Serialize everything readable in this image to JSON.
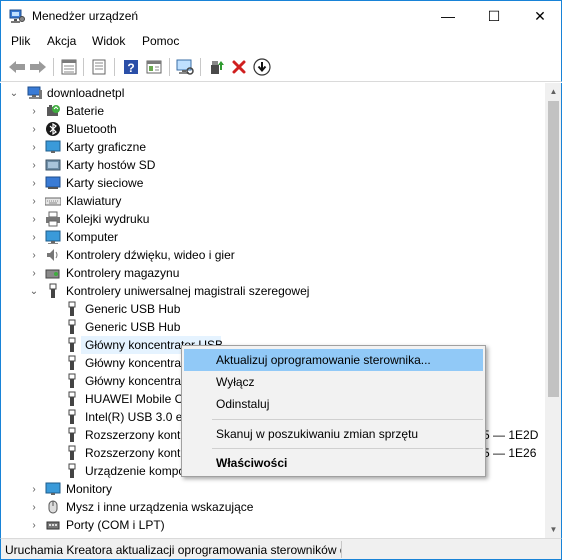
{
  "window": {
    "title": "Menedżer urządzeń",
    "minimize": "—",
    "maximize": "☐",
    "close": "✕"
  },
  "menu": [
    "Plik",
    "Akcja",
    "Widok",
    "Pomoc"
  ],
  "toolbar": {
    "icons": [
      "back-icon",
      "forward-icon",
      "properties-view-icon",
      "list-view-icon",
      "help-icon",
      "details-icon",
      "monitor-scan-icon",
      "update-driver-icon",
      "uninstall-icon",
      "disable-icon"
    ]
  },
  "tree": {
    "root": "downloadnetpl",
    "categories": [
      {
        "label": "Baterie",
        "icon": "battery-icon"
      },
      {
        "label": "Bluetooth",
        "icon": "bluetooth-icon"
      },
      {
        "label": "Karty graficzne",
        "icon": "display-adapter-icon"
      },
      {
        "label": "Karty hostów SD",
        "icon": "sd-host-icon"
      },
      {
        "label": "Karty sieciowe",
        "icon": "network-adapter-icon"
      },
      {
        "label": "Klawiatury",
        "icon": "keyboard-icon"
      },
      {
        "label": "Kolejki wydruku",
        "icon": "printer-icon"
      },
      {
        "label": "Komputer",
        "icon": "computer-icon"
      },
      {
        "label": "Kontrolery dźwięku, wideo i gier",
        "icon": "speaker-icon"
      },
      {
        "label": "Kontrolery magazynu",
        "icon": "storage-icon"
      },
      {
        "label": "Kontrolery uniwersalnej magistrali szeregowej",
        "icon": "usb-icon",
        "expanded": true
      }
    ],
    "usb_children": [
      {
        "label": "Generic USB Hub"
      },
      {
        "label": "Generic USB Hub"
      },
      {
        "label": "Główny koncentrator USB",
        "selected": true
      },
      {
        "label": "Główny koncentrat"
      },
      {
        "label": "Główny koncentrat"
      },
      {
        "label": "HUAWEI Mobile C"
      },
      {
        "label": "Intel(R) USB 3.0 eX"
      },
      {
        "label": "Rozszerzony kontr",
        "suffix": "5 — 1E2D"
      },
      {
        "label": "Rozszerzony kontr",
        "suffix": "5 — 1E26"
      },
      {
        "label": "Urządzenie kompo"
      }
    ],
    "after": [
      {
        "label": "Monitory",
        "icon": "monitor-icon"
      },
      {
        "label": "Mysz i inne urządzenia wskazujące",
        "icon": "mouse-icon"
      },
      {
        "label": "Porty (COM i LPT)",
        "icon": "port-icon"
      }
    ]
  },
  "context_menu": {
    "items": [
      {
        "label": "Aktualizuj oprogramowanie sterownika...",
        "highlight": true
      },
      {
        "label": "Wyłącz"
      },
      {
        "label": "Odinstaluj"
      },
      {
        "label": "Skanuj w poszukiwaniu zmian sprzętu"
      },
      {
        "label": "Właściwości",
        "bold": true
      }
    ]
  },
  "status": "Uruchamia Kreatora aktualizacji oprogramowania sterowników dla zaznaczonego urządzenia."
}
